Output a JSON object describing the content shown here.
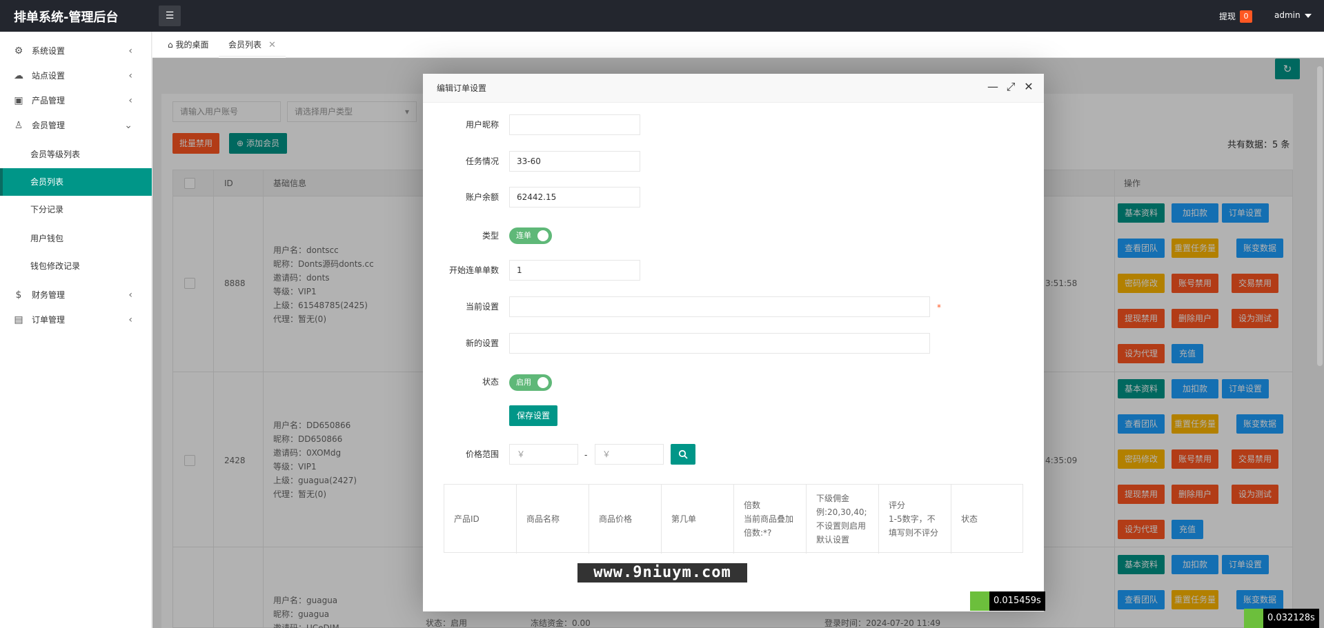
{
  "header": {
    "title": "排单系统-管理后台",
    "withdraw_label": "提现",
    "withdraw_count": "0",
    "user": "admin"
  },
  "sidebar": {
    "items": [
      {
        "label": "系统设置",
        "icon": "gear-icon"
      },
      {
        "label": "站点设置",
        "icon": "site-icon"
      },
      {
        "label": "产品管理",
        "icon": "cube-icon"
      },
      {
        "label": "会员管理",
        "icon": "user-icon"
      },
      {
        "label": "财务管理",
        "icon": "dollar-icon"
      },
      {
        "label": "订单管理",
        "icon": "box-icon"
      }
    ],
    "member_sub": [
      "会员等级列表",
      "会员列表",
      "下分记录",
      "用户钱包",
      "钱包修改记录"
    ]
  },
  "tabs": [
    {
      "label": "我的桌面"
    },
    {
      "label": "会员列表"
    }
  ],
  "toolbar": {
    "account_placeholder": "请输入用户账号",
    "type_placeholder": "请选择用户类型",
    "bulk_disable": "批量禁用",
    "add_member": "添加会员",
    "total": "共有数据：5 条"
  },
  "table": {
    "headers": [
      "ID",
      "基础信息",
      "操作"
    ],
    "rows": [
      {
        "id": "8888",
        "info": [
          "用户名：dontscc",
          "昵称：Donts源码donts.cc",
          "邀请码：donts",
          "等级：VIP1",
          "上级：61548785(2425)",
          "代理：暂无(0)"
        ],
        "time_frag": "3:51:58"
      },
      {
        "id": "2428",
        "info": [
          "用户名：DD650866",
          "昵称：DD650866",
          "邀请码：0XOMdg",
          "等级：VIP1",
          "上级：guagua(2427)",
          "代理：暂无(0)"
        ],
        "time_frag": "4:35:09"
      },
      {
        "id": "",
        "info": [
          "用户名：guagua",
          "昵称：guagua",
          "邀请码：UCeDIM"
        ],
        "status": "状态：启用",
        "frozen": "冻结资金：0.00",
        "login": "登录时间：2024-07-20 11:49"
      }
    ],
    "actions": [
      "基本资料",
      "加扣款",
      "订单设置",
      "查看团队",
      "重置任务量",
      "账变数据",
      "密码修改",
      "账号禁用",
      "交易禁用",
      "提现禁用",
      "删除用户",
      "设为测试",
      "设为代理",
      "充值"
    ]
  },
  "modal": {
    "title": "编辑订单设置",
    "fields": {
      "nickname_label": "用户昵称",
      "task_label": "任务情况",
      "task_value": "33-60",
      "balance_label": "账户余额",
      "balance_value": "62442.15",
      "type_label": "类型",
      "type_switch": "连单",
      "start_label": "开始连单单数",
      "start_value": "1",
      "current_label": "当前设置",
      "current_required": "*",
      "new_label": "新的设置",
      "status_label": "状态",
      "status_switch": "启用",
      "save": "保存设置",
      "price_label": "价格范围",
      "price_placeholder": "￥",
      "price_sep": "-"
    },
    "product_table": {
      "headers": [
        [
          "产品ID"
        ],
        [
          "商品名称"
        ],
        [
          "商品价格"
        ],
        [
          "第几单"
        ],
        [
          "倍数",
          "当前商品叠加",
          "倍数:*?"
        ],
        [
          "下级佣金",
          "例:20,30,40;",
          "不设置则启用",
          "默认设置"
        ],
        [
          "评分",
          "1-5数字，不",
          "填写则不评分"
        ],
        [
          "状态"
        ]
      ]
    }
  },
  "watermark": "www.9niuym.com",
  "timers": [
    "0.015459s",
    "0.032128s"
  ]
}
